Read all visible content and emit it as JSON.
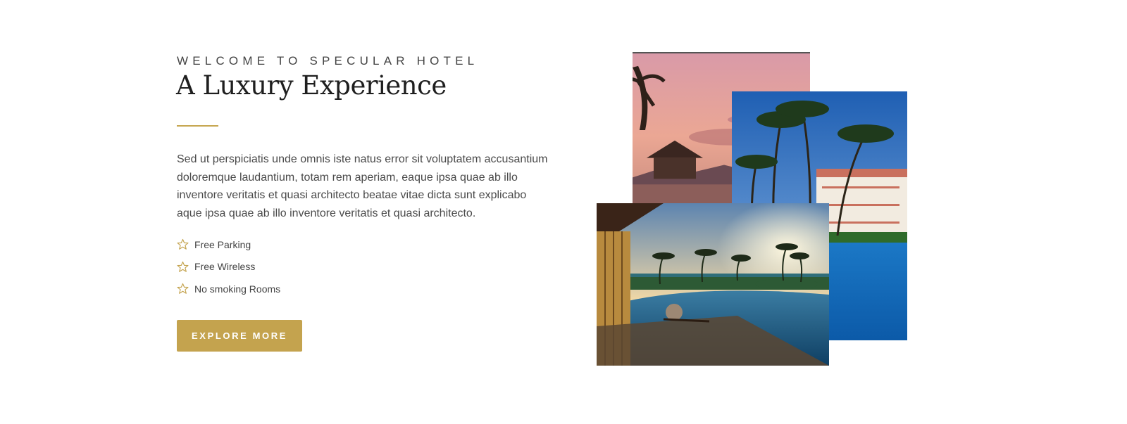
{
  "intro": {
    "eyebrow": "WELCOME TO SPECULAR HOTEL",
    "title": "A Luxury Experience",
    "description": "Sed ut perspiciatis unde omnis iste natus error sit voluptatem accusantium doloremque laudantium, totam rem aperiam, eaque ipsa quae ab illo inventore veritatis et quasi architecto beatae vitae dicta sunt explicabo aque ipsa quae ab illo inventore veritatis et quasi architecto."
  },
  "features": [
    {
      "icon": "star-outline-icon",
      "label": "Free Parking"
    },
    {
      "icon": "star-outline-icon",
      "label": "Free Wireless"
    },
    {
      "icon": "star-outline-icon",
      "label": "No smoking Rooms"
    }
  ],
  "cta": {
    "label": "EXPLORE MORE"
  },
  "colors": {
    "accent": "#c4a34e",
    "heading": "#1f1f1f",
    "body_text": "#4a4a4a"
  }
}
